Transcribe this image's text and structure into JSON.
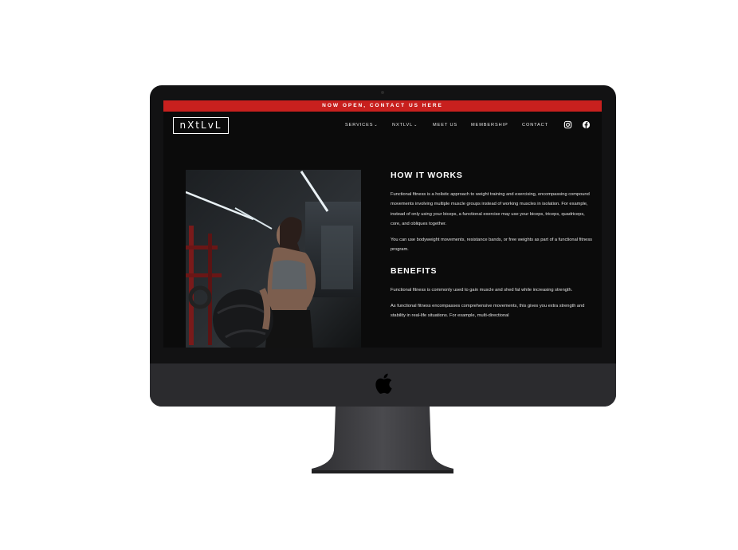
{
  "banner": {
    "text": "NOW OPEN, CONTACT US HERE"
  },
  "brand": {
    "logo": "nXtLvL"
  },
  "nav": {
    "services": "SERVICES",
    "nxtlvl": "NXTLVL",
    "meet_us": "MEET US",
    "membership": "MEMBERSHIP",
    "contact": "CONTACT"
  },
  "social": {
    "icons": [
      "instagram-icon",
      "facebook-icon"
    ]
  },
  "content": {
    "how_title": "HOW IT WORKS",
    "how_p1": "Functional fitness is a holistic approach to weight training and exercising, encompassing compound movements involving multiple muscle groups instead of working muscles in isolation. For example, instead of only using your biceps, a functional exercise may use your biceps, triceps, quadriceps, core, and obliques together.",
    "how_p2": "You can use bodyweight movements, resistance bands, or free weights as part of a functional fitness program.",
    "benefits_title": "BENEFITS",
    "benefits_p1": "Functional fitness is commonly used to gain muscle and shed fat while increasing strength.",
    "benefits_p2": "As functional fitness encompasses comprehensive movements, this gives you extra strength and stability in real-life situations. For example, multi-directional"
  },
  "colors": {
    "banner": "#c8201e",
    "screen_bg": "#0b0b0b",
    "device": "#2b2b2e",
    "text": "#ffffff"
  }
}
